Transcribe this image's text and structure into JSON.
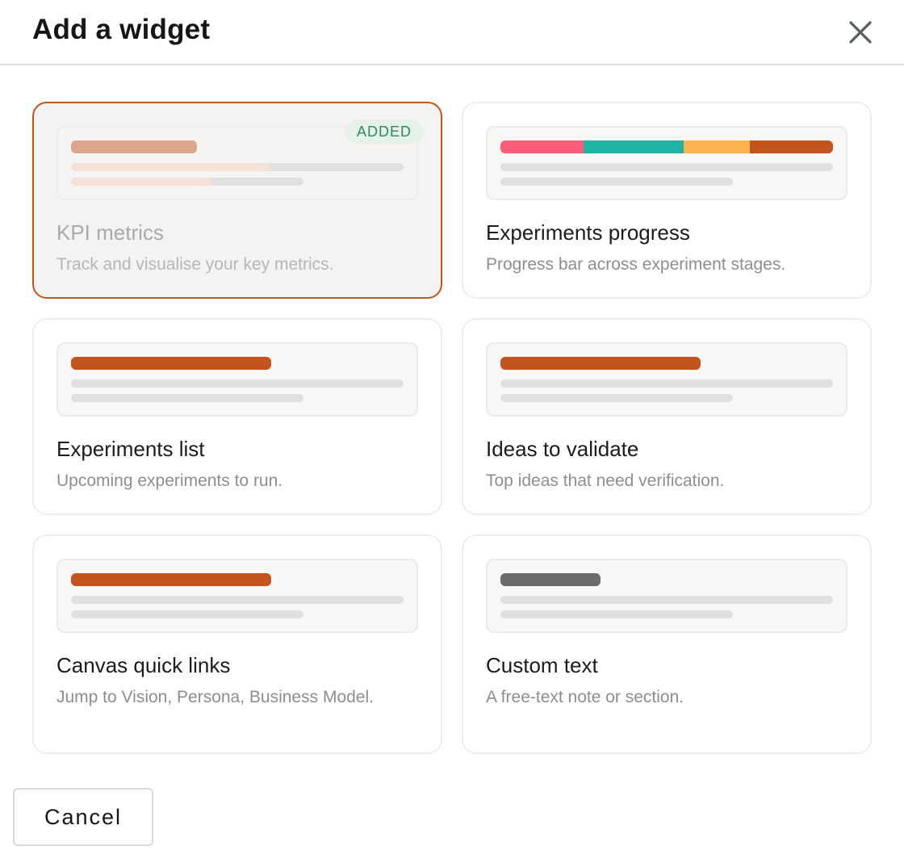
{
  "dialog": {
    "title": "Add a widget",
    "close_icon": "close-icon",
    "cancel_label": "Cancel"
  },
  "colors": {
    "accent": "#c4541e",
    "added_border": "#c4541e",
    "added_badge_bg": "#e4f2ea",
    "added_badge_text": "#2f8a5c"
  },
  "widgets": [
    {
      "title": "KPI metrics",
      "description": "Track and visualise your key metrics.",
      "added": true,
      "badge": "ADDED",
      "preview": "kpi"
    },
    {
      "title": "Experiments progress",
      "description": "Progress bar across experiment stages.",
      "added": false,
      "preview": "progress",
      "segment_colors": [
        "#ff5c7c",
        "#1fb3a6",
        "#fdb24f",
        "#c4541e"
      ]
    },
    {
      "title": "Experiments list",
      "description": "Upcoming experiments to run.",
      "added": false,
      "preview": "list"
    },
    {
      "title": "Ideas to validate",
      "description": "Top ideas that need verification.",
      "added": false,
      "preview": "list"
    },
    {
      "title": "Canvas quick links",
      "description": "Jump to Vision, Persona, Business Model.",
      "added": false,
      "preview": "list"
    },
    {
      "title": "Custom text",
      "description": "A free-text note or section.",
      "added": false,
      "preview": "text"
    }
  ]
}
